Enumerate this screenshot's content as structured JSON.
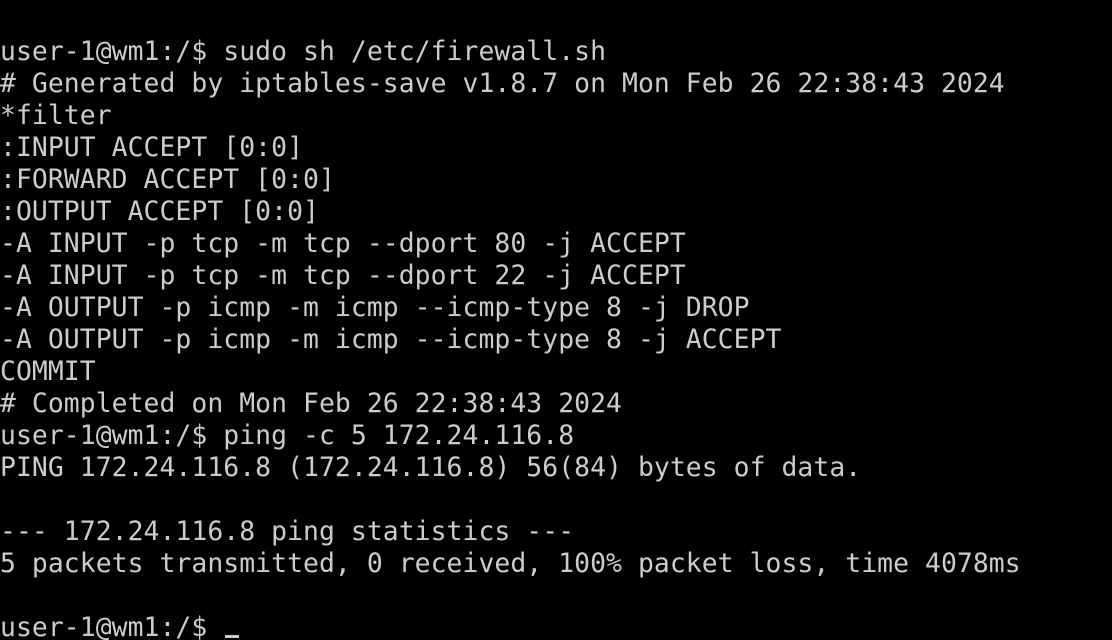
{
  "terminal": {
    "lines": [
      "user-1@wm1:/$ sudo sh /etc/firewall.sh",
      "# Generated by iptables-save v1.8.7 on Mon Feb 26 22:38:43 2024",
      "*filter",
      ":INPUT ACCEPT [0:0]",
      ":FORWARD ACCEPT [0:0]",
      ":OUTPUT ACCEPT [0:0]",
      "-A INPUT -p tcp -m tcp --dport 80 -j ACCEPT",
      "-A INPUT -p tcp -m tcp --dport 22 -j ACCEPT",
      "-A OUTPUT -p icmp -m icmp --icmp-type 8 -j DROP",
      "-A OUTPUT -p icmp -m icmp --icmp-type 8 -j ACCEPT",
      "COMMIT",
      "# Completed on Mon Feb 26 22:38:43 2024",
      "user-1@wm1:/$ ping -c 5 172.24.116.8",
      "PING 172.24.116.8 (172.24.116.8) 56(84) bytes of data.",
      "",
      "--- 172.24.116.8 ping statistics ---",
      "5 packets transmitted, 0 received, 100% packet loss, time 4078ms",
      "",
      "user-1@wm1:/$ "
    ],
    "colors": {
      "background": "#000000",
      "foreground": "#cccccc"
    }
  }
}
